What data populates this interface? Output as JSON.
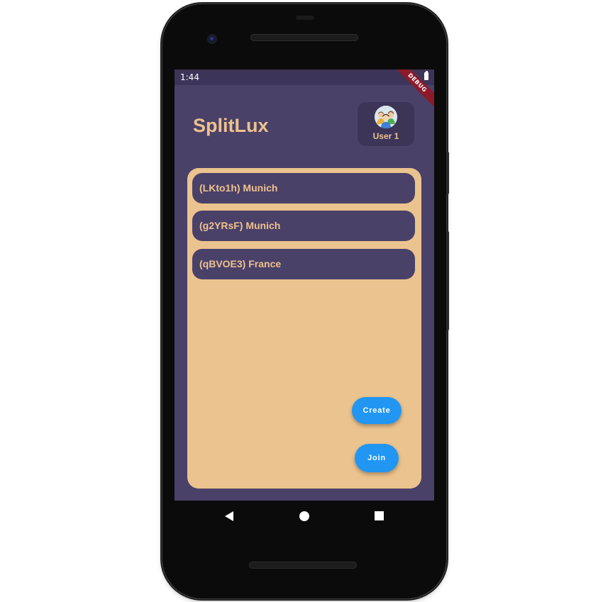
{
  "status_bar": {
    "time": "1:44",
    "debug_banner": "DEBUG"
  },
  "header": {
    "app_title": "SplitLux",
    "user": {
      "name": "User 1",
      "avatar_icon": "group-avatar-icon"
    }
  },
  "groups": [
    {
      "label": "(LKto1h) Munich"
    },
    {
      "label": "(g2YRsF) Munich"
    },
    {
      "label": "(qBVOE3) France"
    }
  ],
  "actions": {
    "create_label": "Create",
    "join_label": "Join"
  },
  "nav": {
    "back_icon": "back-triangle-icon",
    "home_icon": "home-circle-icon",
    "recents_icon": "recents-square-icon"
  },
  "colors": {
    "background": "#4a4169",
    "panel": "#ebc38e",
    "accent_text": "#eec28e",
    "button": "#2196f3"
  }
}
